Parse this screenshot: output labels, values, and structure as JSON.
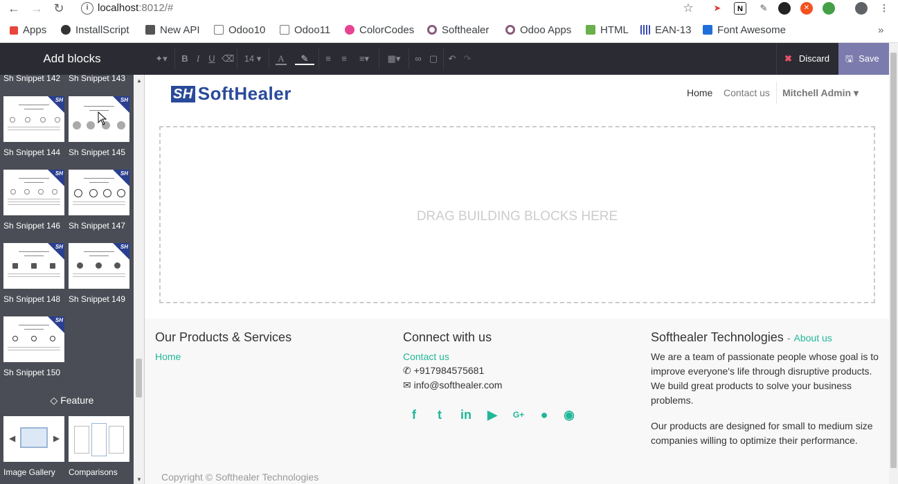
{
  "browser": {
    "url_host": "localhost",
    "url_rest": ":8012/#",
    "bookmarks": [
      {
        "label": "Apps",
        "color": "#e8453c"
      },
      {
        "label": "InstallScript",
        "color": "#333333"
      },
      {
        "label": "New API",
        "color": "#555555"
      },
      {
        "label": "Odoo10",
        "color": "#777777"
      },
      {
        "label": "Odoo11",
        "color": "#777777"
      },
      {
        "label": "ColorCodes",
        "color": "#e84393"
      },
      {
        "label": "Softhealer",
        "color": "#875a7b"
      },
      {
        "label": "Odoo Apps",
        "color": "#875a7b"
      },
      {
        "label": "HTML",
        "color": "#6ab04c"
      },
      {
        "label": "EAN-13",
        "color": "#3949ab"
      },
      {
        "label": "Font Awesome",
        "color": "#1e6fd9"
      }
    ]
  },
  "editor": {
    "sidebar_title": "Add blocks",
    "font_size": "14",
    "discard_label": "Discard",
    "save_label": "Save"
  },
  "snippets": {
    "top_labels": [
      "Sh Snippet 142",
      "Sh Snippet 143"
    ],
    "items": [
      {
        "label": "Sh Snippet 144",
        "badge": "SH"
      },
      {
        "label": "Sh Snippet 145",
        "badge": "SH"
      },
      {
        "label": "Sh Snippet 146",
        "badge": "SH"
      },
      {
        "label": "Sh Snippet 147",
        "badge": "SH"
      },
      {
        "label": "Sh Snippet 148",
        "badge": "SH"
      },
      {
        "label": "Sh Snippet 149",
        "badge": "SH"
      },
      {
        "label": "Sh Snippet 150",
        "badge": "SH"
      }
    ],
    "feature_title": "Feature",
    "feature_items": [
      "Image Gallery",
      "Comparisons"
    ]
  },
  "site": {
    "logo_mark": "SH",
    "logo_text": "SoftHealer",
    "nav": [
      "Home",
      "Contact us"
    ],
    "user": "Mitchell Admin",
    "drop_text": "DRAG BUILDING BLOCKS HERE"
  },
  "footer": {
    "col1_title": "Our Products & Services",
    "col1_link": "Home",
    "col2_title": "Connect with us",
    "col2_link": "Contact us",
    "phone": "+917984575681",
    "email": "info@softhealer.com",
    "col3_title": "Softhealer Technologies",
    "col3_sep": "-",
    "col3_link": "About us",
    "about_p1": "We are a team of passionate people whose goal is to improve everyone's life through disruptive products. We build great products to solve your business problems.",
    "about_p2": "Our products are designed for small to medium size companies willing to optimize their performance.",
    "social": [
      "facebook-icon",
      "twitter-icon",
      "linkedin-icon",
      "youtube-icon",
      "google-plus-icon",
      "github-icon",
      "instagram-icon"
    ],
    "copyright": "Copyright © Softhealer Technologies"
  },
  "colors": {
    "accent": "#21b799",
    "save": "#7c7bad",
    "toolbar": "#2b2b33",
    "sidebar": "#4a4d55"
  }
}
